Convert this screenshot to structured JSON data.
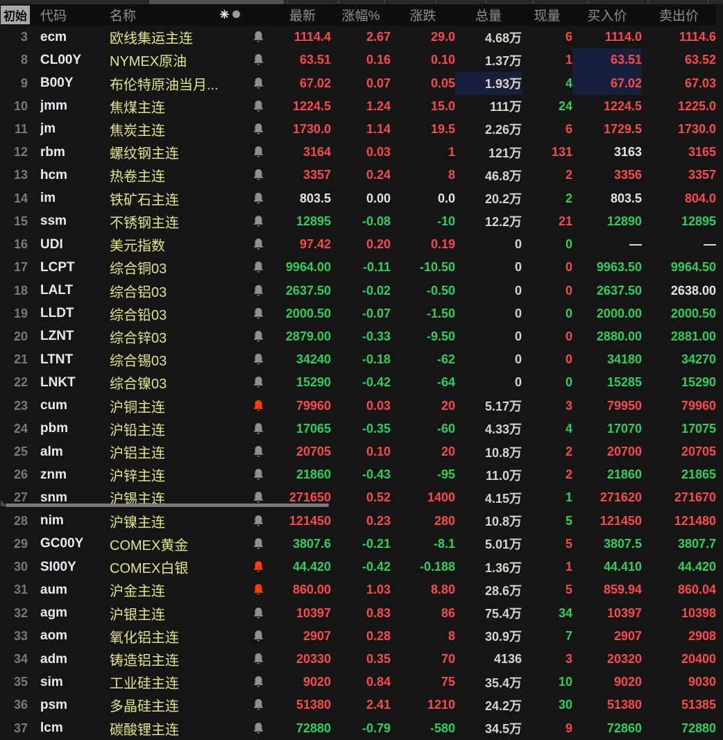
{
  "header": {
    "corner_tab": "初始",
    "columns": [
      {
        "key": "num",
        "label": ""
      },
      {
        "key": "code",
        "label": "代码"
      },
      {
        "key": "name",
        "label": "名称"
      },
      {
        "key": "bell",
        "label": ""
      },
      {
        "key": "latest",
        "label": "最新"
      },
      {
        "key": "pct",
        "label": "涨幅%"
      },
      {
        "key": "chg",
        "label": "涨跌"
      },
      {
        "key": "totvol",
        "label": "总量"
      },
      {
        "key": "curvol",
        "label": "现量"
      },
      {
        "key": "bid",
        "label": "买入价"
      },
      {
        "key": "ask",
        "label": "卖出价"
      }
    ],
    "name_icons": [
      "asterisk-icon",
      "dot-icon"
    ]
  },
  "colors": {
    "up_red": "#fb4a4a",
    "down_green": "#2ed05a",
    "name_yellow": "#e3e388",
    "neutral_white": "#e8e5de",
    "volume_white": "#d9d5c9",
    "alert_bell_orange": "#ff3d00",
    "bell_gray": "#8f8f8f",
    "highlight_navy": "#171f3a",
    "background": "#151515"
  },
  "rows": [
    {
      "num": "3",
      "code": "ecm",
      "name": "欧线集运主连",
      "bell": "gray",
      "hl": [],
      "cells": [
        {
          "v": "1114.4",
          "c": "r"
        },
        {
          "v": "2.67",
          "c": "r"
        },
        {
          "v": "29.0",
          "c": "r"
        },
        {
          "v": "4.68万",
          "c": "t"
        },
        {
          "v": "6",
          "c": "r"
        },
        {
          "v": "1114.0",
          "c": "r"
        },
        {
          "v": "1114.6",
          "c": "r"
        }
      ]
    },
    {
      "num": "8",
      "code": "CL00Y",
      "name": "NYMEX原油",
      "bell": "gray",
      "hl": [
        5
      ],
      "cells": [
        {
          "v": "63.51",
          "c": "r"
        },
        {
          "v": "0.16",
          "c": "r"
        },
        {
          "v": "0.10",
          "c": "r"
        },
        {
          "v": "1.37万",
          "c": "t"
        },
        {
          "v": "1",
          "c": "r"
        },
        {
          "v": "63.51",
          "c": "r"
        },
        {
          "v": "63.52",
          "c": "r"
        }
      ]
    },
    {
      "num": "9",
      "code": "B00Y",
      "name": "布伦特原油当月...",
      "bell": "gray",
      "hl": [
        3,
        5
      ],
      "cells": [
        {
          "v": "67.02",
          "c": "r"
        },
        {
          "v": "0.07",
          "c": "r"
        },
        {
          "v": "0.05",
          "c": "r"
        },
        {
          "v": "1.93万",
          "c": "t"
        },
        {
          "v": "4",
          "c": "g"
        },
        {
          "v": "67.02",
          "c": "r"
        },
        {
          "v": "67.03",
          "c": "r"
        }
      ]
    },
    {
      "num": "10",
      "code": "jmm",
      "name": "焦煤主连",
      "bell": "gray",
      "hl": [],
      "cells": [
        {
          "v": "1224.5",
          "c": "r"
        },
        {
          "v": "1.24",
          "c": "r"
        },
        {
          "v": "15.0",
          "c": "r"
        },
        {
          "v": "111万",
          "c": "t"
        },
        {
          "v": "24",
          "c": "g"
        },
        {
          "v": "1224.5",
          "c": "r"
        },
        {
          "v": "1225.0",
          "c": "r"
        }
      ]
    },
    {
      "num": "11",
      "code": "jm",
      "name": "焦炭主连",
      "bell": "gray",
      "hl": [],
      "cells": [
        {
          "v": "1730.0",
          "c": "r"
        },
        {
          "v": "1.14",
          "c": "r"
        },
        {
          "v": "19.5",
          "c": "r"
        },
        {
          "v": "2.26万",
          "c": "t"
        },
        {
          "v": "6",
          "c": "r"
        },
        {
          "v": "1729.5",
          "c": "r"
        },
        {
          "v": "1730.0",
          "c": "r"
        }
      ]
    },
    {
      "num": "12",
      "code": "rbm",
      "name": "螺纹钢主连",
      "bell": "gray",
      "hl": [],
      "cells": [
        {
          "v": "3164",
          "c": "r"
        },
        {
          "v": "0.03",
          "c": "r"
        },
        {
          "v": "1",
          "c": "r"
        },
        {
          "v": "121万",
          "c": "t"
        },
        {
          "v": "131",
          "c": "r"
        },
        {
          "v": "3163",
          "c": "w"
        },
        {
          "v": "3165",
          "c": "r"
        }
      ]
    },
    {
      "num": "13",
      "code": "hcm",
      "name": "热卷主连",
      "bell": "gray",
      "hl": [],
      "cells": [
        {
          "v": "3357",
          "c": "r"
        },
        {
          "v": "0.24",
          "c": "r"
        },
        {
          "v": "8",
          "c": "r"
        },
        {
          "v": "46.8万",
          "c": "t"
        },
        {
          "v": "2",
          "c": "r"
        },
        {
          "v": "3356",
          "c": "r"
        },
        {
          "v": "3357",
          "c": "r"
        }
      ]
    },
    {
      "num": "14",
      "code": "im",
      "name": "铁矿石主连",
      "bell": "gray",
      "hl": [],
      "cells": [
        {
          "v": "803.5",
          "c": "w"
        },
        {
          "v": "0.00",
          "c": "w"
        },
        {
          "v": "0.0",
          "c": "w"
        },
        {
          "v": "20.2万",
          "c": "t"
        },
        {
          "v": "2",
          "c": "g"
        },
        {
          "v": "803.5",
          "c": "w"
        },
        {
          "v": "804.0",
          "c": "r"
        }
      ]
    },
    {
      "num": "15",
      "code": "ssm",
      "name": "不锈钢主连",
      "bell": "gray",
      "hl": [],
      "cells": [
        {
          "v": "12895",
          "c": "g"
        },
        {
          "v": "-0.08",
          "c": "g"
        },
        {
          "v": "-10",
          "c": "g"
        },
        {
          "v": "12.2万",
          "c": "t"
        },
        {
          "v": "21",
          "c": "r"
        },
        {
          "v": "12890",
          "c": "g"
        },
        {
          "v": "12895",
          "c": "g"
        }
      ]
    },
    {
      "num": "16",
      "code": "UDI",
      "name": "美元指数",
      "bell": "gray",
      "hl": [],
      "cells": [
        {
          "v": "97.42",
          "c": "r"
        },
        {
          "v": "0.20",
          "c": "r"
        },
        {
          "v": "0.19",
          "c": "r"
        },
        {
          "v": "0",
          "c": "t"
        },
        {
          "v": "0",
          "c": "g"
        },
        {
          "v": "—",
          "c": "w"
        },
        {
          "v": "—",
          "c": "w"
        }
      ]
    },
    {
      "num": "17",
      "code": "LCPT",
      "name": "综合铜03",
      "bell": "gray",
      "hl": [],
      "cells": [
        {
          "v": "9964.00",
          "c": "g"
        },
        {
          "v": "-0.11",
          "c": "g"
        },
        {
          "v": "-10.50",
          "c": "g"
        },
        {
          "v": "0",
          "c": "t"
        },
        {
          "v": "0",
          "c": "r"
        },
        {
          "v": "9963.50",
          "c": "g"
        },
        {
          "v": "9964.50",
          "c": "g"
        }
      ]
    },
    {
      "num": "18",
      "code": "LALT",
      "name": "综合铝03",
      "bell": "gray",
      "hl": [],
      "cells": [
        {
          "v": "2637.50",
          "c": "g"
        },
        {
          "v": "-0.02",
          "c": "g"
        },
        {
          "v": "-0.50",
          "c": "g"
        },
        {
          "v": "0",
          "c": "t"
        },
        {
          "v": "0",
          "c": "r"
        },
        {
          "v": "2637.50",
          "c": "g"
        },
        {
          "v": "2638.00",
          "c": "w"
        }
      ]
    },
    {
      "num": "19",
      "code": "LLDT",
      "name": "综合铅03",
      "bell": "gray",
      "hl": [],
      "cells": [
        {
          "v": "2000.50",
          "c": "g"
        },
        {
          "v": "-0.07",
          "c": "g"
        },
        {
          "v": "-1.50",
          "c": "g"
        },
        {
          "v": "0",
          "c": "t"
        },
        {
          "v": "0",
          "c": "g"
        },
        {
          "v": "2000.00",
          "c": "g"
        },
        {
          "v": "2000.50",
          "c": "g"
        }
      ]
    },
    {
      "num": "20",
      "code": "LZNT",
      "name": "综合锌03",
      "bell": "gray",
      "hl": [],
      "cells": [
        {
          "v": "2879.00",
          "c": "g"
        },
        {
          "v": "-0.33",
          "c": "g"
        },
        {
          "v": "-9.50",
          "c": "g"
        },
        {
          "v": "0",
          "c": "t"
        },
        {
          "v": "0",
          "c": "r"
        },
        {
          "v": "2880.00",
          "c": "g"
        },
        {
          "v": "2881.00",
          "c": "g"
        }
      ]
    },
    {
      "num": "21",
      "code": "LTNT",
      "name": "综合锡03",
      "bell": "gray",
      "hl": [],
      "cells": [
        {
          "v": "34240",
          "c": "g"
        },
        {
          "v": "-0.18",
          "c": "g"
        },
        {
          "v": "-62",
          "c": "g"
        },
        {
          "v": "0",
          "c": "t"
        },
        {
          "v": "0",
          "c": "r"
        },
        {
          "v": "34180",
          "c": "g"
        },
        {
          "v": "34270",
          "c": "g"
        }
      ]
    },
    {
      "num": "22",
      "code": "LNKT",
      "name": "综合镍03",
      "bell": "gray",
      "hl": [],
      "cells": [
        {
          "v": "15290",
          "c": "g"
        },
        {
          "v": "-0.42",
          "c": "g"
        },
        {
          "v": "-64",
          "c": "g"
        },
        {
          "v": "0",
          "c": "t"
        },
        {
          "v": "0",
          "c": "g"
        },
        {
          "v": "15285",
          "c": "g"
        },
        {
          "v": "15290",
          "c": "g"
        }
      ]
    },
    {
      "num": "23",
      "code": "cum",
      "name": "沪铜主连",
      "bell": "orange",
      "hl": [],
      "cells": [
        {
          "v": "79960",
          "c": "r"
        },
        {
          "v": "0.03",
          "c": "r"
        },
        {
          "v": "20",
          "c": "r"
        },
        {
          "v": "5.17万",
          "c": "t"
        },
        {
          "v": "3",
          "c": "r"
        },
        {
          "v": "79950",
          "c": "r"
        },
        {
          "v": "79960",
          "c": "r"
        }
      ]
    },
    {
      "num": "24",
      "code": "pbm",
      "name": "沪铅主连",
      "bell": "gray",
      "hl": [],
      "cells": [
        {
          "v": "17065",
          "c": "g"
        },
        {
          "v": "-0.35",
          "c": "g"
        },
        {
          "v": "-60",
          "c": "g"
        },
        {
          "v": "4.33万",
          "c": "t"
        },
        {
          "v": "4",
          "c": "g"
        },
        {
          "v": "17070",
          "c": "g"
        },
        {
          "v": "17075",
          "c": "g"
        }
      ]
    },
    {
      "num": "25",
      "code": "alm",
      "name": "沪铝主连",
      "bell": "gray",
      "hl": [],
      "cells": [
        {
          "v": "20705",
          "c": "r"
        },
        {
          "v": "0.10",
          "c": "r"
        },
        {
          "v": "20",
          "c": "r"
        },
        {
          "v": "10.8万",
          "c": "t"
        },
        {
          "v": "2",
          "c": "r"
        },
        {
          "v": "20700",
          "c": "r"
        },
        {
          "v": "20705",
          "c": "r"
        }
      ]
    },
    {
      "num": "26",
      "code": "znm",
      "name": "沪锌主连",
      "bell": "gray",
      "hl": [],
      "cells": [
        {
          "v": "21860",
          "c": "g"
        },
        {
          "v": "-0.43",
          "c": "g"
        },
        {
          "v": "-95",
          "c": "g"
        },
        {
          "v": "11.0万",
          "c": "t"
        },
        {
          "v": "2",
          "c": "r"
        },
        {
          "v": "21860",
          "c": "g"
        },
        {
          "v": "21865",
          "c": "g"
        }
      ]
    },
    {
      "num": "27",
      "code": "snm",
      "name": "沪锡主连",
      "bell": "gray",
      "hl": [],
      "cells": [
        {
          "v": "271650",
          "c": "r"
        },
        {
          "v": "0.52",
          "c": "r"
        },
        {
          "v": "1400",
          "c": "r"
        },
        {
          "v": "4.15万",
          "c": "t"
        },
        {
          "v": "1",
          "c": "g"
        },
        {
          "v": "271620",
          "c": "r"
        },
        {
          "v": "271670",
          "c": "r"
        }
      ]
    },
    {
      "num": "28",
      "code": "nim",
      "name": "沪镍主连",
      "bell": "gray",
      "hl": [],
      "cells": [
        {
          "v": "121450",
          "c": "r"
        },
        {
          "v": "0.23",
          "c": "r"
        },
        {
          "v": "280",
          "c": "r"
        },
        {
          "v": "10.8万",
          "c": "t"
        },
        {
          "v": "5",
          "c": "g"
        },
        {
          "v": "121450",
          "c": "r"
        },
        {
          "v": "121480",
          "c": "r"
        }
      ]
    },
    {
      "num": "29",
      "code": "GC00Y",
      "name": "COMEX黄金",
      "bell": "gray",
      "hl": [],
      "cells": [
        {
          "v": "3807.6",
          "c": "g"
        },
        {
          "v": "-0.21",
          "c": "g"
        },
        {
          "v": "-8.1",
          "c": "g"
        },
        {
          "v": "5.01万",
          "c": "t"
        },
        {
          "v": "5",
          "c": "r"
        },
        {
          "v": "3807.5",
          "c": "g"
        },
        {
          "v": "3807.7",
          "c": "g"
        }
      ]
    },
    {
      "num": "30",
      "code": "SI00Y",
      "name": "COMEX白银",
      "bell": "orange",
      "hl": [],
      "cells": [
        {
          "v": "44.420",
          "c": "g"
        },
        {
          "v": "-0.42",
          "c": "g"
        },
        {
          "v": "-0.188",
          "c": "g"
        },
        {
          "v": "1.36万",
          "c": "t"
        },
        {
          "v": "1",
          "c": "r"
        },
        {
          "v": "44.410",
          "c": "g"
        },
        {
          "v": "44.420",
          "c": "g"
        }
      ]
    },
    {
      "num": "31",
      "code": "aum",
      "name": "沪金主连",
      "bell": "orange",
      "hl": [],
      "cells": [
        {
          "v": "860.00",
          "c": "r"
        },
        {
          "v": "1.03",
          "c": "r"
        },
        {
          "v": "8.80",
          "c": "r"
        },
        {
          "v": "28.6万",
          "c": "t"
        },
        {
          "v": "5",
          "c": "r"
        },
        {
          "v": "859.94",
          "c": "r"
        },
        {
          "v": "860.04",
          "c": "r"
        }
      ]
    },
    {
      "num": "32",
      "code": "agm",
      "name": "沪银主连",
      "bell": "gray",
      "hl": [],
      "cells": [
        {
          "v": "10397",
          "c": "r"
        },
        {
          "v": "0.83",
          "c": "r"
        },
        {
          "v": "86",
          "c": "r"
        },
        {
          "v": "75.4万",
          "c": "t"
        },
        {
          "v": "34",
          "c": "g"
        },
        {
          "v": "10397",
          "c": "r"
        },
        {
          "v": "10398",
          "c": "r"
        }
      ]
    },
    {
      "num": "33",
      "code": "aom",
      "name": "氧化铝主连",
      "bell": "gray",
      "hl": [],
      "cells": [
        {
          "v": "2907",
          "c": "r"
        },
        {
          "v": "0.28",
          "c": "r"
        },
        {
          "v": "8",
          "c": "r"
        },
        {
          "v": "30.9万",
          "c": "t"
        },
        {
          "v": "7",
          "c": "g"
        },
        {
          "v": "2907",
          "c": "r"
        },
        {
          "v": "2908",
          "c": "r"
        }
      ]
    },
    {
      "num": "34",
      "code": "adm",
      "name": "铸造铝主连",
      "bell": "gray",
      "hl": [],
      "cells": [
        {
          "v": "20330",
          "c": "r"
        },
        {
          "v": "0.35",
          "c": "r"
        },
        {
          "v": "70",
          "c": "r"
        },
        {
          "v": "4136",
          "c": "t"
        },
        {
          "v": "3",
          "c": "r"
        },
        {
          "v": "20320",
          "c": "r"
        },
        {
          "v": "20400",
          "c": "r"
        }
      ]
    },
    {
      "num": "35",
      "code": "sim",
      "name": "工业硅主连",
      "bell": "gray",
      "hl": [],
      "cells": [
        {
          "v": "9020",
          "c": "r"
        },
        {
          "v": "0.84",
          "c": "r"
        },
        {
          "v": "75",
          "c": "r"
        },
        {
          "v": "35.4万",
          "c": "t"
        },
        {
          "v": "10",
          "c": "g"
        },
        {
          "v": "9020",
          "c": "r"
        },
        {
          "v": "9030",
          "c": "r"
        }
      ]
    },
    {
      "num": "36",
      "code": "psm",
      "name": "多晶硅主连",
      "bell": "gray",
      "hl": [],
      "cells": [
        {
          "v": "51380",
          "c": "r"
        },
        {
          "v": "2.41",
          "c": "r"
        },
        {
          "v": "1210",
          "c": "r"
        },
        {
          "v": "24.2万",
          "c": "t"
        },
        {
          "v": "30",
          "c": "g"
        },
        {
          "v": "51380",
          "c": "r"
        },
        {
          "v": "51385",
          "c": "r"
        }
      ]
    },
    {
      "num": "37",
      "code": "lcm",
      "name": "碳酸锂主连",
      "bell": "gray",
      "hl": [],
      "cells": [
        {
          "v": "72880",
          "c": "g"
        },
        {
          "v": "-0.79",
          "c": "g"
        },
        {
          "v": "-580",
          "c": "g"
        },
        {
          "v": "34.5万",
          "c": "t"
        },
        {
          "v": "9",
          "c": "r"
        },
        {
          "v": "72860",
          "c": "g"
        },
        {
          "v": "72880",
          "c": "g"
        }
      ]
    }
  ]
}
